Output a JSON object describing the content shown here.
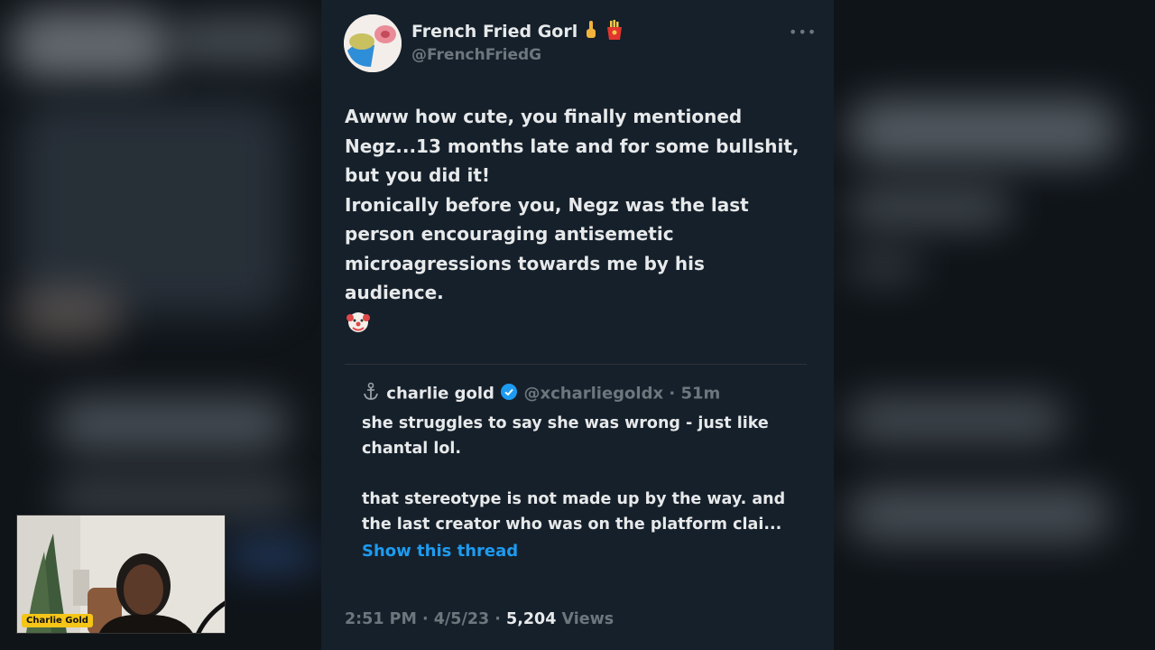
{
  "tweet": {
    "author_name": "French Fried Gorl",
    "author_handle": "@FrenchFriedG",
    "body_lines": [
      "Awww how cute, you finally mentioned",
      "Negz...13 months late and for some bullshit,",
      "but you did it!",
      "Ironically before you, Negz was the last",
      "person encouraging antisemetic",
      "microagressions towards me by his",
      "audience."
    ],
    "quoted": {
      "name": "charlie gold",
      "handle_time": "@xcharliegoldx · 51m",
      "text_lines": [
        "she struggles to say she was wrong - just like",
        "chantal lol.",
        "",
        "that stereotype is not made up by the way. and",
        "the last creator who was on the platform clai..."
      ],
      "show_thread": "Show this thread"
    },
    "meta": {
      "time_date": "2:51 PM · 4/5/23 · ",
      "views_count": "5,204",
      "views_label": " Views"
    }
  },
  "webcam": {
    "label": "Charlie Gold"
  },
  "colors": {
    "card_bg": "#15202b",
    "text": "#e7e9ea",
    "muted": "#6e767d",
    "link": "#1d9bf0",
    "verified": "#1d9bf0",
    "label_bg": "#f5c518"
  }
}
